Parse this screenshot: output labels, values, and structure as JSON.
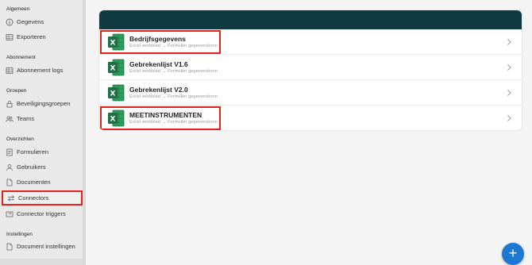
{
  "sidebar": {
    "sections": [
      {
        "label": "Algemeen"
      },
      {
        "label": "Abonnement"
      },
      {
        "label": "Groepen"
      },
      {
        "label": "Overzichten"
      },
      {
        "label": "Instellingen"
      }
    ],
    "items": [
      {
        "label": "Gegevens",
        "icon": "info-icon"
      },
      {
        "label": "Exporteren",
        "icon": "grid-icon"
      },
      {
        "label": "Abonnement logs",
        "icon": "grid-icon"
      },
      {
        "label": "Beveiligingsgroepen",
        "icon": "lock-icon"
      },
      {
        "label": "Teams",
        "icon": "users-icon"
      },
      {
        "label": "Formulieren",
        "icon": "form-icon"
      },
      {
        "label": "Gebruikers",
        "icon": "user-icon"
      },
      {
        "label": "Documenten",
        "icon": "document-icon"
      },
      {
        "label": "Connectors",
        "icon": "arrows-icon"
      },
      {
        "label": "Connector triggers",
        "icon": "trigger-icon"
      },
      {
        "label": "Document instellingen",
        "icon": "document-icon"
      }
    ]
  },
  "connectors": [
    {
      "title": "Bedrijfsgegevens",
      "subtitle": "Excel werkblad → Formulier gegevensbron"
    },
    {
      "title": "Gebrekenlijst V1.6",
      "subtitle": "Excel werkblad → Formulier gegevensbron"
    },
    {
      "title": "Gebrekenlijst V2.0",
      "subtitle": "Excel werkblad → Formulier gegevensbron"
    },
    {
      "title": "MEETINSTRUMENTEN",
      "subtitle": "Excel werkblad → Formulier gegevensbron"
    }
  ],
  "fab": {
    "label": "+"
  },
  "colors": {
    "header": "#0f3a42",
    "highlight": "#e0241b",
    "fab": "#1d78d4",
    "excel": "#1e7145"
  }
}
